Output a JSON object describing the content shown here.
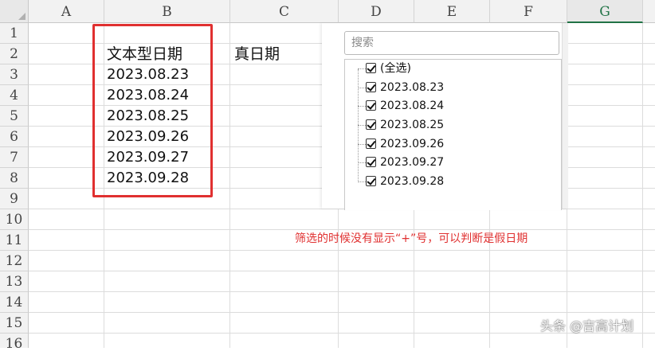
{
  "columns": [
    "A",
    "B",
    "C",
    "D",
    "E",
    "F",
    "G"
  ],
  "selected_column": "G",
  "rows": [
    "1",
    "2",
    "3",
    "4",
    "5",
    "6",
    "7",
    "8",
    "9",
    "10",
    "11",
    "12",
    "13",
    "14",
    "15",
    "16"
  ],
  "cells": {
    "B2": "文本型日期",
    "C2": "真日期",
    "B3": "2023.08.23",
    "B4": "2023.08.24",
    "B5": "2023.08.25",
    "B6": "2023.09.26",
    "B7": "2023.09.27",
    "B8": "2023.09.28"
  },
  "filter_panel": {
    "search_placeholder": "搜索",
    "items": [
      {
        "label": "(全选)",
        "checked": true
      },
      {
        "label": "2023.08.23",
        "checked": true
      },
      {
        "label": "2023.08.24",
        "checked": true
      },
      {
        "label": "2023.08.25",
        "checked": true
      },
      {
        "label": "2023.09.26",
        "checked": true
      },
      {
        "label": "2023.09.27",
        "checked": true
      },
      {
        "label": "2023.09.28",
        "checked": true
      }
    ]
  },
  "annotation": "筛选的时候没有显示“+”号，可以判断是假日期",
  "watermark": "头条 @吉高计划",
  "colors": {
    "highlight": "#e03030",
    "selected_header": "#217346"
  }
}
